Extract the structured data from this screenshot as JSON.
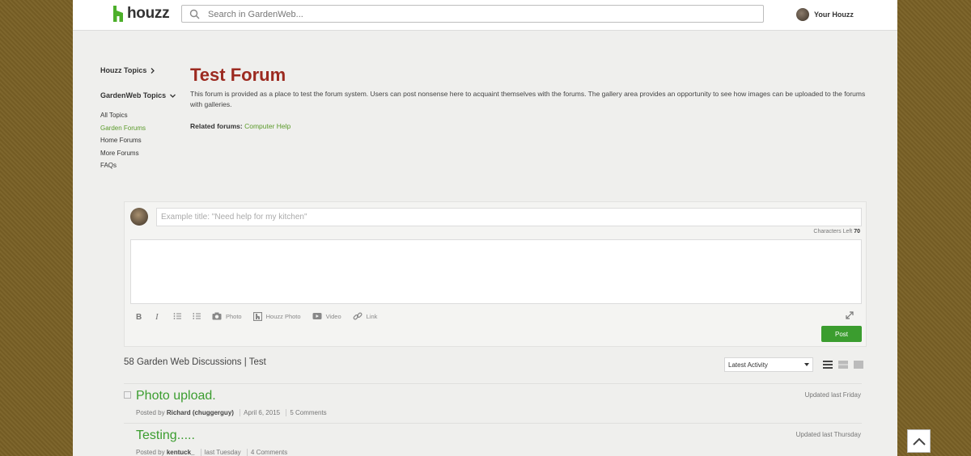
{
  "header": {
    "logo_text": "houzz",
    "search_placeholder": "Search in GardenWeb...",
    "user_label": "Your Houzz"
  },
  "sidebar": {
    "houzz_topics": "Houzz Topics",
    "gardenweb_topics": "GardenWeb Topics",
    "links": [
      {
        "label": "All Topics",
        "active": false
      },
      {
        "label": "Garden Forums",
        "active": true
      },
      {
        "label": "Home Forums",
        "active": false
      },
      {
        "label": "More Forums",
        "active": false
      },
      {
        "label": "FAQs",
        "active": false
      }
    ]
  },
  "forum": {
    "title": "Test Forum",
    "description": "This forum is provided as a place to test the forum system. Users can post nonsense here to acquaint themselves with the forums. The gallery area provides an opportunity to see how images can be uploaded to the forums with galleries.",
    "related_label": "Related forums:",
    "related_link": "Computer Help"
  },
  "composer": {
    "title_placeholder": "Example title: \"Need help for my kitchen\"",
    "chars_label": "Characters Left",
    "chars_value": "70",
    "photo": "Photo",
    "houzz_photo": "Houzz Photo",
    "video": "Video",
    "link": "Link",
    "post": "Post"
  },
  "discussions": {
    "count_text": "58 Garden Web Discussions | Test",
    "sort_value": "Latest Activity",
    "items": [
      {
        "title": "Photo upload.",
        "posted_by": "Posted by",
        "author": "Richard (chuggerguy)",
        "date": "April 6, 2015",
        "comments": "5 Comments",
        "updated": "Updated last Friday"
      },
      {
        "title": "Testing.....",
        "posted_by": "Posted by",
        "author": "kentuck_",
        "date": "last Tuesday",
        "comments": "4 Comments",
        "updated": "Updated last Thursday"
      }
    ]
  },
  "colors": {
    "accent_green": "#3b9d2f",
    "title_red": "#9c2a20",
    "link_green": "#5a9a2a"
  }
}
